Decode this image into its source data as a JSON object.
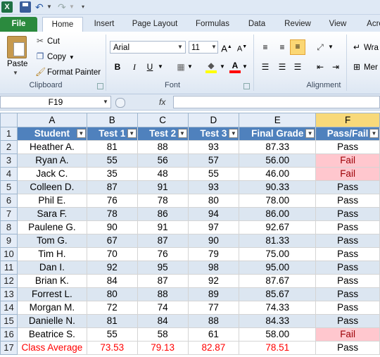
{
  "app": {
    "logo": "X"
  },
  "tabs": [
    {
      "label": "File"
    },
    {
      "label": "Home"
    },
    {
      "label": "Insert"
    },
    {
      "label": "Page Layout"
    },
    {
      "label": "Formulas"
    },
    {
      "label": "Data"
    },
    {
      "label": "Review"
    },
    {
      "label": "View"
    },
    {
      "label": "Acro"
    }
  ],
  "ribbon": {
    "clipboard": {
      "label": "Clipboard",
      "paste": "Paste",
      "cut": "Cut",
      "copy": "Copy",
      "format_painter": "Format Painter"
    },
    "font": {
      "label": "Font",
      "name": "Arial",
      "size": "11"
    },
    "alignment": {
      "label": "Alignment",
      "wrap": "Wra",
      "merge": "Mer"
    }
  },
  "formula_bar": {
    "name_box": "F19",
    "fx": "fx",
    "value": ""
  },
  "columns": [
    "A",
    "B",
    "C",
    "D",
    "E",
    "F"
  ],
  "headers": [
    "Student",
    "Test 1",
    "Test 2",
    "Test 3",
    "Final Grade",
    "Pass/Fail"
  ],
  "rows": [
    [
      "Heather A.",
      "81",
      "88",
      "93",
      "87.33",
      "Pass"
    ],
    [
      "Ryan A.",
      "55",
      "56",
      "57",
      "56.00",
      "Fail"
    ],
    [
      "Jack C.",
      "35",
      "48",
      "55",
      "46.00",
      "Fail"
    ],
    [
      "Colleen D.",
      "87",
      "91",
      "93",
      "90.33",
      "Pass"
    ],
    [
      "Phil E.",
      "76",
      "78",
      "80",
      "78.00",
      "Pass"
    ],
    [
      "Sara F.",
      "78",
      "86",
      "94",
      "86.00",
      "Pass"
    ],
    [
      "Paulene G.",
      "90",
      "91",
      "97",
      "92.67",
      "Pass"
    ],
    [
      "Tom G.",
      "67",
      "87",
      "90",
      "81.33",
      "Pass"
    ],
    [
      "Tim H.",
      "70",
      "76",
      "79",
      "75.00",
      "Pass"
    ],
    [
      "Dan I.",
      "92",
      "95",
      "98",
      "95.00",
      "Pass"
    ],
    [
      "Brian K.",
      "84",
      "87",
      "92",
      "87.67",
      "Pass"
    ],
    [
      "Forrest L.",
      "80",
      "88",
      "89",
      "85.67",
      "Pass"
    ],
    [
      "Morgan M.",
      "72",
      "74",
      "77",
      "74.33",
      "Pass"
    ],
    [
      "Danielle N.",
      "81",
      "84",
      "88",
      "84.33",
      "Pass"
    ],
    [
      "Beatrice S.",
      "55",
      "58",
      "61",
      "58.00",
      "Fail"
    ]
  ],
  "average_row": [
    "Class Average",
    "73.53",
    "79.13",
    "82.87",
    "78.51",
    "Pass"
  ],
  "colors": {
    "header_fill": "#4f81bd",
    "band_fill": "#dce6f1",
    "fail_fill": "#ffc7ce",
    "average_text": "#ff0000"
  }
}
